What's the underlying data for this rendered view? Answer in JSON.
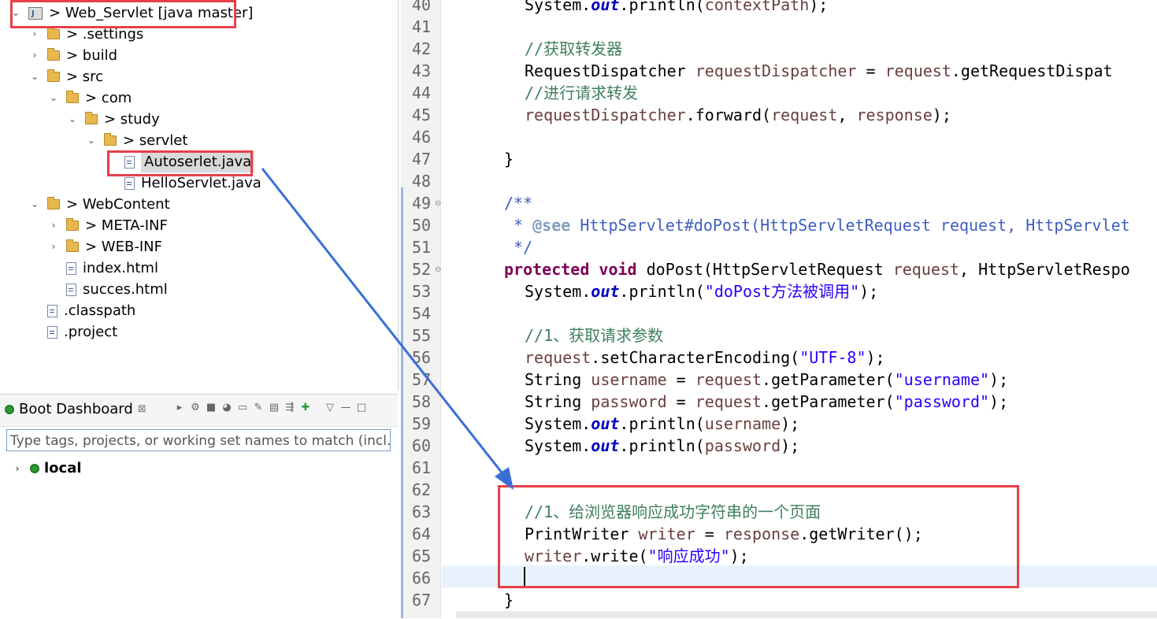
{
  "explorer": {
    "items": [
      {
        "label": "> Web_Servlet [java master]",
        "kind": "project",
        "chevron": "down"
      },
      {
        "label": "> .settings",
        "kind": "folder",
        "chevron": "right"
      },
      {
        "label": "> build",
        "kind": "folder",
        "chevron": "right"
      },
      {
        "label": "> src",
        "kind": "folder",
        "chevron": "down"
      },
      {
        "label": "> com",
        "kind": "folder",
        "chevron": "down"
      },
      {
        "label": "> study",
        "kind": "folder",
        "chevron": "down"
      },
      {
        "label": "> servlet",
        "kind": "folder",
        "chevron": "down"
      },
      {
        "label": "Autoserlet.java",
        "kind": "file",
        "chevron": "none"
      },
      {
        "label": "HelloServlet.java",
        "kind": "file",
        "chevron": "none"
      },
      {
        "label": "> WebContent",
        "kind": "folder",
        "chevron": "down"
      },
      {
        "label": "> META-INF",
        "kind": "folder",
        "chevron": "right"
      },
      {
        "label": "> WEB-INF",
        "kind": "folder",
        "chevron": "right"
      },
      {
        "label": "index.html",
        "kind": "file",
        "chevron": "none"
      },
      {
        "label": "succes.html",
        "kind": "file",
        "chevron": "none"
      },
      {
        "label": ".classpath",
        "kind": "file",
        "chevron": "none"
      },
      {
        "label": ".project",
        "kind": "file",
        "chevron": "none"
      }
    ]
  },
  "boot": {
    "title": "Boot Dashboard",
    "close_glyph": "⊠",
    "filter_placeholder": "Type tags, projects, or working set names to match (incl.",
    "local_label": "local"
  },
  "editor": {
    "lines": [
      {
        "n": "40",
        "code": "System.out.println(contextPath);"
      },
      {
        "n": "41",
        "code": ""
      },
      {
        "n": "42",
        "code": "//获取转发器"
      },
      {
        "n": "43",
        "code": "RequestDispatcher requestDispatcher = request.getRequestDispat"
      },
      {
        "n": "44",
        "code": "//进行请求转发"
      },
      {
        "n": "45",
        "code": "requestDispatcher.forward(request, response);"
      },
      {
        "n": "46",
        "code": ""
      },
      {
        "n": "47",
        "code": "}"
      },
      {
        "n": "48",
        "code": ""
      },
      {
        "n": "49",
        "code": "/**"
      },
      {
        "n": "50",
        "code": " * @see HttpServlet#doPost(HttpServletRequest request, HttpServlet"
      },
      {
        "n": "51",
        "code": " */"
      },
      {
        "n": "52",
        "code": "protected void doPost(HttpServletRequest request, HttpServletRespo"
      },
      {
        "n": "53",
        "code": "System.out.println(\"doPost方法被调用\");"
      },
      {
        "n": "54",
        "code": ""
      },
      {
        "n": "55",
        "code": "//1、获取请求参数"
      },
      {
        "n": "56",
        "code": "request.setCharacterEncoding(\"UTF-8\");"
      },
      {
        "n": "57",
        "code": "String username = request.getParameter(\"username\");"
      },
      {
        "n": "58",
        "code": "String password = request.getParameter(\"password\");"
      },
      {
        "n": "59",
        "code": "System.out.println(username);"
      },
      {
        "n": "60",
        "code": "System.out.println(password);"
      },
      {
        "n": "61",
        "code": ""
      },
      {
        "n": "62",
        "code": ""
      },
      {
        "n": "63",
        "code": "//1、给浏览器响应成功字符串的一个页面"
      },
      {
        "n": "64",
        "code": "PrintWriter writer = response.getWriter();"
      },
      {
        "n": "65",
        "code": "writer.write(\"响应成功\");"
      },
      {
        "n": "66",
        "code": ""
      },
      {
        "n": "67",
        "code": "}"
      }
    ]
  },
  "colors": {
    "annotation_red": "#e5404a",
    "arrow_blue": "#3a6fd8",
    "keyword": "#7f0055",
    "string": "#2a00ff",
    "comment": "#3f7f5f"
  }
}
